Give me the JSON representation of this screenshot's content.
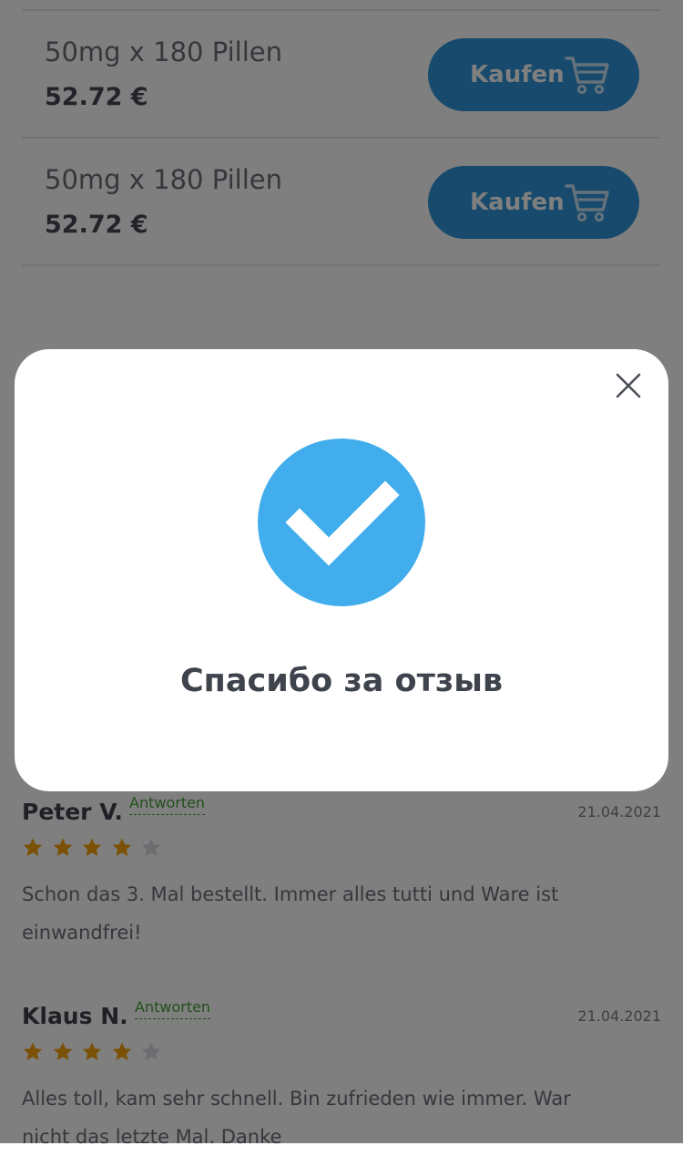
{
  "products": [
    {
      "name": "50mg x 180 Pillen",
      "price": "52.72 €",
      "button_label": "Kaufen"
    },
    {
      "name": "50mg x 180 Pillen",
      "price": "52.72 €",
      "button_label": "Kaufen"
    }
  ],
  "reviews": [
    {
      "author": "Peter V.",
      "reply_label": "Antworten",
      "date": "21.04.2021",
      "rating": 4,
      "max_rating": 5,
      "text": "Schon das 3. Mal bestellt. Immer alles tutti und Ware ist einwandfrei!"
    },
    {
      "author": "Klaus N.",
      "reply_label": "Antworten",
      "date": "21.04.2021",
      "rating": 4,
      "max_rating": 5,
      "text": "Alles toll, kam sehr schnell. Bin zufrieden wie immer. War nicht das letzte Mal. Danke"
    }
  ],
  "modal": {
    "message": "Спасибо за отзыв",
    "close_icon": "close-icon",
    "status_icon": "check-circle-icon"
  },
  "colors": {
    "accent_button": "#2f95d9",
    "success_check": "#41adec",
    "star_filled": "#f5a20b",
    "star_empty": "#d9dbe0",
    "reply_link": "#45a037"
  }
}
